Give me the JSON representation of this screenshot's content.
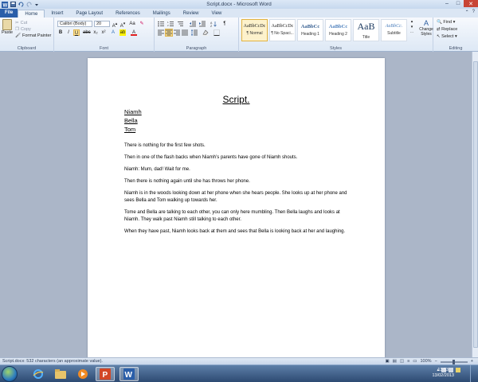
{
  "window": {
    "title": "Script.docx - Microsoft Word"
  },
  "tabs": [
    {
      "label": "File"
    },
    {
      "label": "Home"
    },
    {
      "label": "Insert"
    },
    {
      "label": "Page Layout"
    },
    {
      "label": "References"
    },
    {
      "label": "Mailings"
    },
    {
      "label": "Review"
    },
    {
      "label": "View"
    }
  ],
  "ribbon": {
    "clipboard": {
      "paste_label": "Paste",
      "cut_label": "Cut",
      "copy_label": "Copy",
      "format_painter_label": "Format Painter",
      "group_label": "Clipboard"
    },
    "font": {
      "font_name": "Calibri (Body)",
      "font_size": "20",
      "group_label": "Font"
    },
    "paragraph": {
      "group_label": "Paragraph"
    },
    "styles": {
      "items": [
        {
          "sample": "AaBbCcDc",
          "name": "¶ Normal"
        },
        {
          "sample": "AaBbCcDc",
          "name": "¶ No Spaci..."
        },
        {
          "sample": "AaBbCc",
          "name": "Heading 1"
        },
        {
          "sample": "AaBbCc",
          "name": "Heading 2"
        },
        {
          "sample": "AaB",
          "name": "Title"
        },
        {
          "sample": "AaBbCc.",
          "name": "Subtitle"
        }
      ],
      "change_styles_label": "Change Styles",
      "group_label": "Styles"
    },
    "editing": {
      "find_label": "Find",
      "replace_label": "Replace",
      "select_label": "Select",
      "group_label": "Editing"
    }
  },
  "document": {
    "title": "Script.",
    "cast": [
      "Niamh",
      "Bella",
      "Tom"
    ],
    "paragraphs": [
      "There is nothing for the first few shots.",
      "Then in one of the flash backs when Niamh’s parents have gone of Niamh shouts.",
      "Niamh: Mum, dad! Wait for me.",
      "Then there is nothing again until she has throws her phone.",
      "Niamh is in the woods looking down at her phone when she hears people.  She looks up at her phone and sees Bella and Tom walking up towards her.",
      "Tome and Bella are talking to each other, you can only here mumbling. Then Bella laughs and looks at Niamh. They walk past Niamh still talking to each other.",
      "When they have past, Niamh looks back at them and sees that Bella is looking back at her and laughing."
    ]
  },
  "statusbar": {
    "doc_info": "Script.docx: 532 characters (an approximate value).",
    "zoom": "100%"
  },
  "taskbar": {
    "time": "13:53",
    "date": "13/02/2013"
  },
  "colors": {
    "file_tab": "#2a5ea9",
    "selected_style": "#fdf2cc",
    "close_button": "#c84536"
  }
}
